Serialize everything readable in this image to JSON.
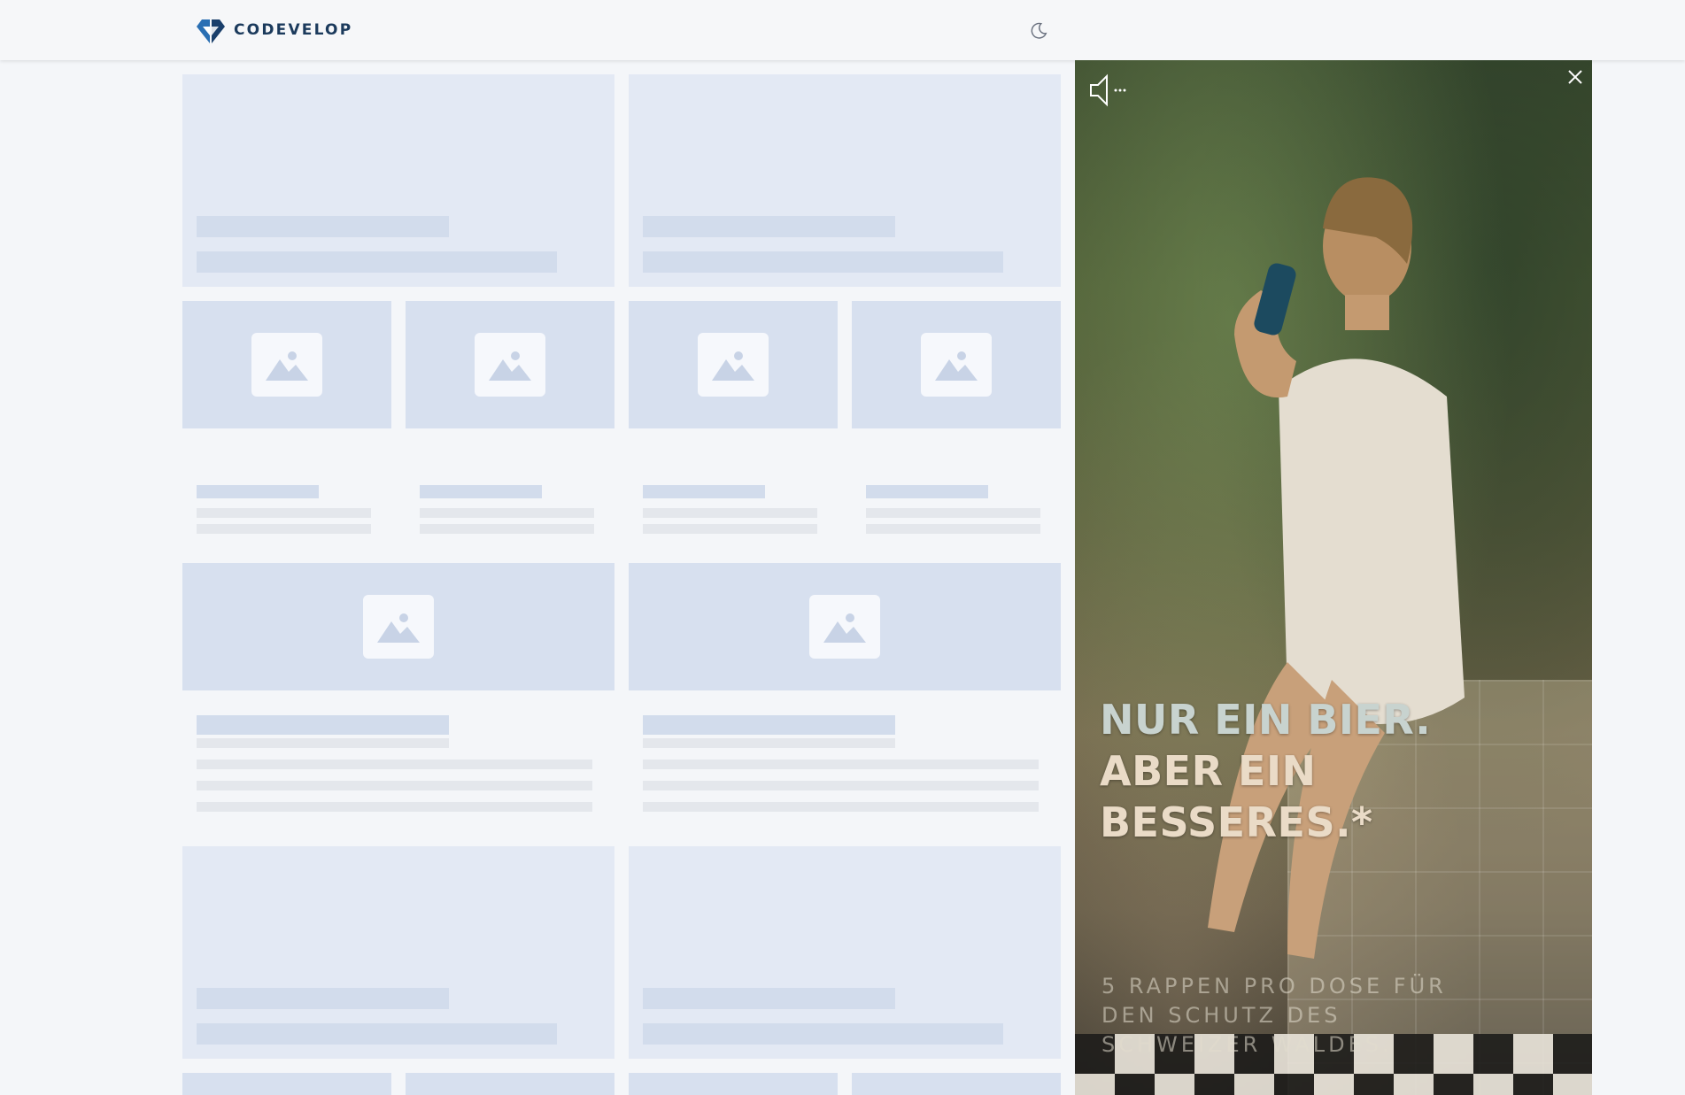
{
  "header": {
    "brand": "CODEVELOP",
    "logo_icon": "codevelop-logo-icon",
    "theme_icon": "moon-icon"
  },
  "ad": {
    "headline_line1": "NUR EIN BIER.",
    "headline_line2": "ABER EIN BESSERES.*",
    "subtext": "5 RAPPEN PRO DOSE FÜR DEN SCHUTZ DES SCHWEIZER WALDES.",
    "mute_icon": "speaker-muted-icon",
    "close_icon": "close-icon"
  },
  "colors": {
    "skeleton_hero": "#e3e9f4",
    "skeleton_bar": "#d2dcec",
    "skeleton_thumb": "#d7e0ef",
    "skeleton_line": "#e4e7ec",
    "brand": "#1b3a5c"
  }
}
